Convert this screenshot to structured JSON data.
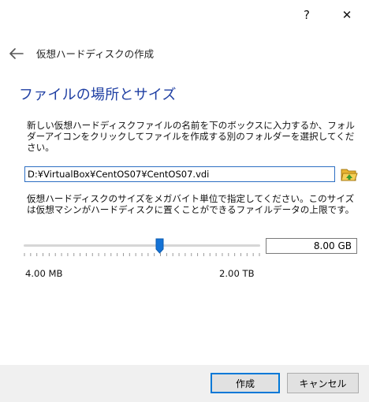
{
  "title_bar": {
    "help_label": "?",
    "close_label": "✕"
  },
  "wizard": {
    "title": "仮想ハードディスクの作成",
    "heading": "ファイルの場所とサイズ",
    "location_description": "新しい仮想ハードディスクファイルの名前を下のボックスに入力するか、フォルダーアイコンをクリックしてファイルを作成する別のフォルダーを選択してください。",
    "file_path": "D:¥VirtualBox¥CentOS07¥CentOS07.vdi",
    "size_description": "仮想ハードディスクのサイズをメガバイト単位で指定してください。このサイズは仮想マシンがハードディスクに置くことができるファイルデータの上限です。",
    "size_value": "8.00 GB",
    "size_slider_fraction": 0.575,
    "min_label": "4.00 MB",
    "max_label": "2.00 TB"
  },
  "buttons": {
    "create": "作成",
    "cancel": "キャンセル"
  },
  "icons": {
    "back": "back-arrow-icon",
    "folder": "folder-open-icon"
  },
  "colors": {
    "heading": "#1f3fa3",
    "accent": "#0078d7",
    "slider_thumb": "#1573d6",
    "footer_bg": "#f0f0f0"
  }
}
